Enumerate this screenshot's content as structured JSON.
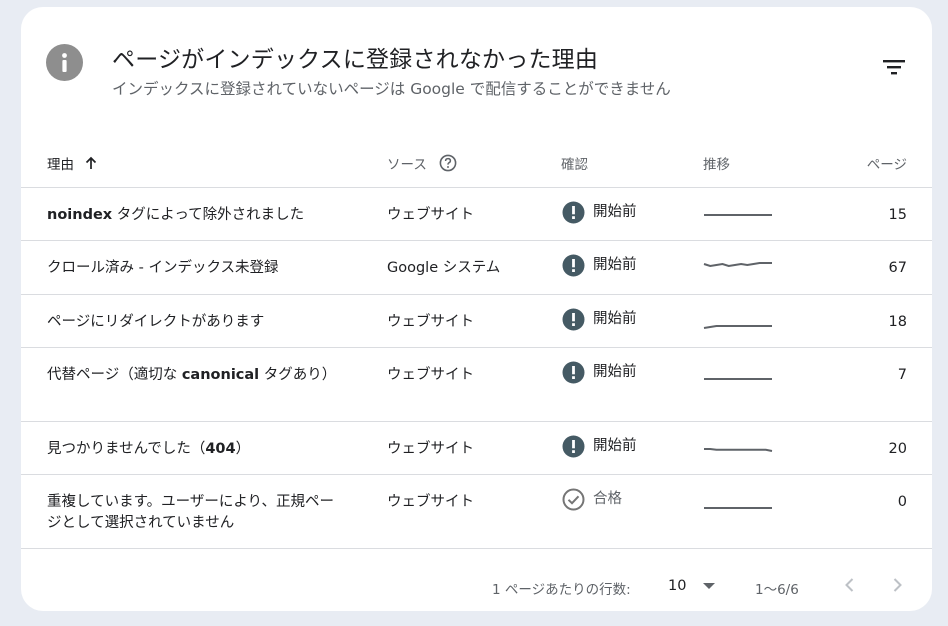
{
  "header": {
    "title": "ページがインデックスに登録されなかった理由",
    "subtitle": "インデックスに登録されていないページは Google で配信することができません"
  },
  "columns": {
    "reason": "理由",
    "source": "ソース",
    "check": "確認",
    "trend": "推移",
    "pages": "ページ"
  },
  "rows": [
    {
      "reason_bold": "noindex",
      "reason": " タグによって除外されました",
      "source": "ウェブサイト",
      "status": "開始前",
      "status_type": "not-started",
      "trend": [
        3,
        3,
        3,
        3,
        3,
        3,
        3,
        3,
        3,
        3,
        3,
        3
      ],
      "pages": "15"
    },
    {
      "reason_bold": "",
      "reason": "クロール済み - インデックス未登録",
      "source": "Google システム",
      "status": "開始前",
      "status_type": "not-started",
      "trend": [
        5,
        4,
        4.5,
        5,
        4,
        4.5,
        5,
        4.5,
        5,
        5.5,
        5.5,
        5.5
      ],
      "pages": "67"
    },
    {
      "reason_bold": "",
      "reason": "ページにリダイレクトがあります",
      "source": "ウェブサイト",
      "status": "開始前",
      "status_type": "not-started",
      "trend": [
        0,
        0.5,
        1,
        1,
        1,
        1,
        1,
        1,
        1,
        1,
        1,
        1
      ],
      "pages": "18"
    },
    {
      "reason_bold": "",
      "reason": "代替ページ（適切な canonical タグあり）",
      "reason_html_bold": "canonical",
      "source": "ウェブサイト",
      "status": "開始前",
      "status_type": "not-started",
      "trend": [
        1,
        1,
        1,
        1,
        1,
        1,
        1,
        1,
        1,
        1,
        1,
        1
      ],
      "pages": "7"
    },
    {
      "reason_bold": "",
      "reason": "見つかりませんでした（404）",
      "reason_html_bold": "404",
      "source": "ウェブサイト",
      "status": "開始前",
      "status_type": "not-started",
      "trend": [
        3,
        3,
        2.6,
        2.6,
        2.6,
        2.6,
        2.6,
        2.6,
        2.6,
        2.6,
        2.6,
        2
      ],
      "pages": "20"
    },
    {
      "reason_bold": "",
      "reason": "重複しています。ユーザーにより、正規ページとして選択されていません",
      "source": "ウェブサイト",
      "status": "合格",
      "status_type": "passed",
      "trend": [
        0,
        0,
        0,
        0,
        0,
        0,
        0,
        0,
        0,
        0,
        0,
        0
      ],
      "pages": "0"
    }
  ],
  "footer": {
    "rows_per_page_label": "1 ページあたりの行数:",
    "rows_per_page_value": "10",
    "range": "1〜6/6"
  },
  "icons": {
    "header": "info-icon",
    "filter": "filter-icon",
    "sort": "arrow-up-icon",
    "help": "help-circle-icon",
    "not_started": "exclamation-circle-icon",
    "passed": "check-circle-icon",
    "dropdown": "triangle-down-icon",
    "prev": "chevron-left-icon",
    "next": "chevron-right-icon"
  },
  "colors": {
    "status_icon": "#455a64",
    "passed_icon": "#757575",
    "trend_line": "#5f6368",
    "info_bg": "#8e8e8e"
  }
}
